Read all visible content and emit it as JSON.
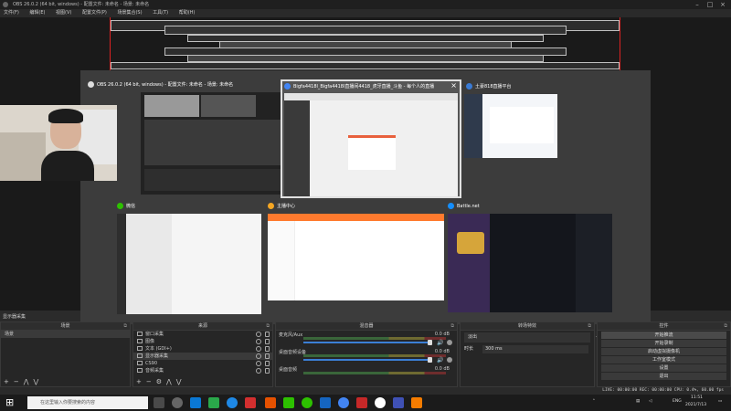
{
  "window": {
    "title": "OBS 26.0.2 (64 bit, windows) - 配置文件: 未命名 - 场景: 未命名"
  },
  "menu": [
    "文件(F)",
    "编辑(E)",
    "视图(V)",
    "配置文件(P)",
    "场景集合(S)",
    "工具(T)",
    "帮助(H)"
  ],
  "task_view": {
    "windows": [
      {
        "title": "OBS 26.0.2 (64 bit, windows) - 配置文件: 未命名 - 场景: 未命名"
      },
      {
        "title": "Bigfa4418l_Bigfa4418l直播间4418_虎牙直播_斗鱼 - 每个人的直播"
      },
      {
        "title": "土豪818直播平台"
      },
      {
        "title": "微信"
      },
      {
        "title": "主播中心"
      },
      {
        "title": "Battle.net"
      }
    ]
  },
  "scene_transition_label": "显示器采集",
  "docks": {
    "scenes": {
      "title": "场景",
      "items": [
        "场景"
      ]
    },
    "sources": {
      "title": "来源",
      "items": [
        "窗口采集",
        "图像",
        "文本 (GDI+)",
        "显示器采集",
        "CS90",
        "音频采集"
      ]
    },
    "mixer": {
      "title": "混音器",
      "channels": [
        {
          "name": "麦克风/Aux",
          "db": "0.0 dB"
        },
        {
          "name": "桌面音频设备",
          "db": "0.0 dB"
        },
        {
          "name": "桌面音频",
          "db": "0.0 dB"
        }
      ]
    },
    "transitions": {
      "title": "转场特效",
      "type": "淡出",
      "duration_label": "时长",
      "duration": "300 ms"
    },
    "controls": {
      "title": "控件",
      "buttons": [
        "开始推流",
        "开始录制",
        "启动虚拟摄像机",
        "工作室模式",
        "设置",
        "退出"
      ]
    }
  },
  "statusbar": {
    "text": "LIVE: 00:00:00   REC: 00:00:00   CPU: 0.4%, 60.00 fps"
  },
  "taskbar": {
    "search_placeholder": "在这里输入你要搜索的内容",
    "lang": "ENG",
    "time": "11:51",
    "date": "2021/7/13"
  }
}
